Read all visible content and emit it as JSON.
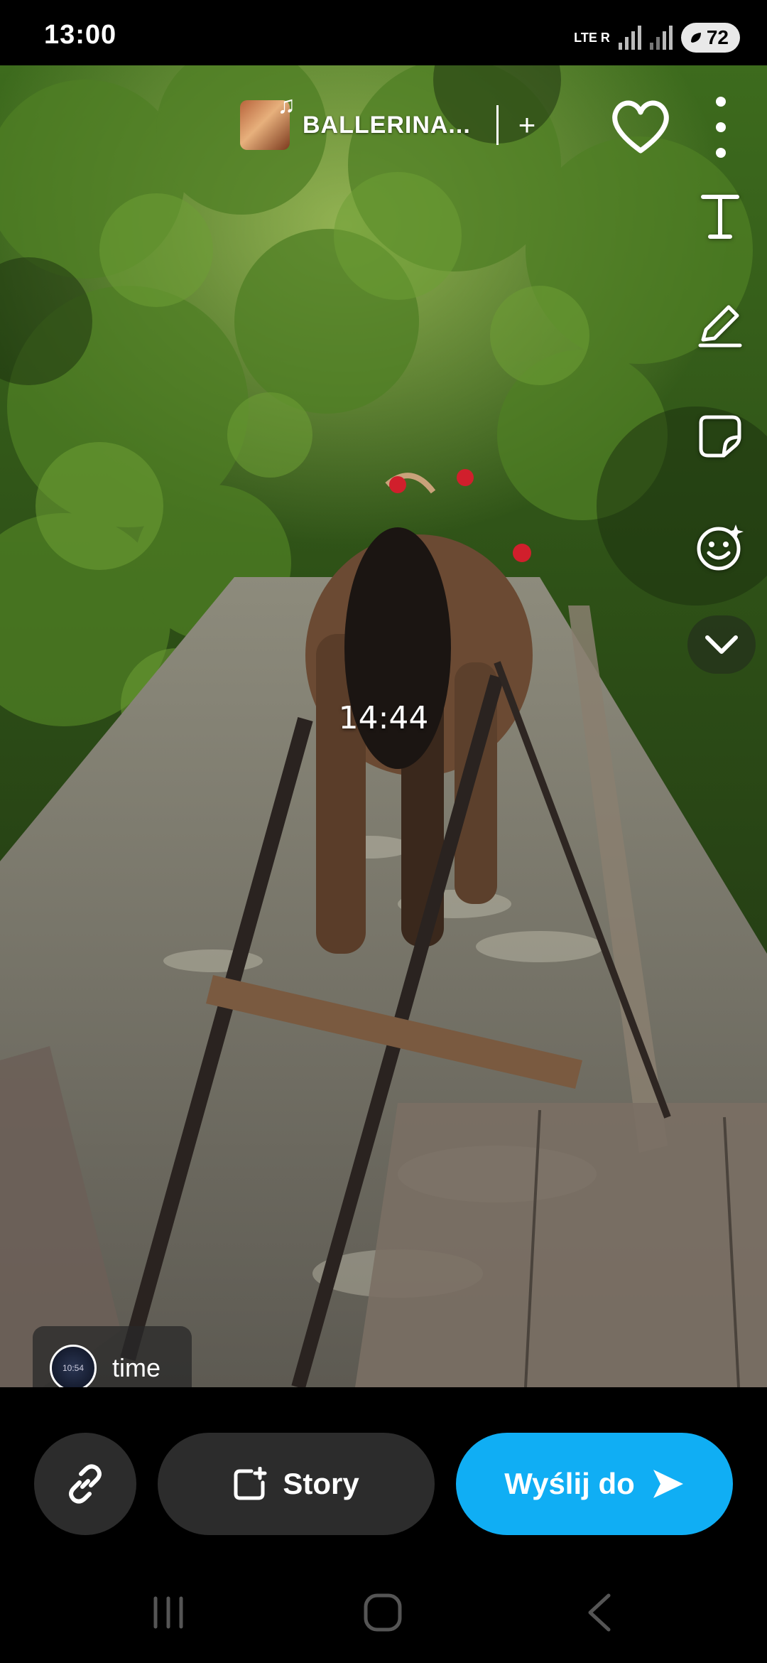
{
  "status_bar": {
    "time": "13:00",
    "network_label": "LTE R",
    "battery": "72"
  },
  "music": {
    "title": "BALLERINA...",
    "add_symbol": "+"
  },
  "sticker": {
    "time_text": "14:44"
  },
  "attachment": {
    "thumb_time": "10:54",
    "label": "time"
  },
  "actions": {
    "story_label": "Story",
    "send_label": "Wyślij do"
  },
  "icons": {
    "heart": "heart-icon",
    "more": "kebab-menu-icon",
    "text": "text-tool-icon",
    "draw": "pencil-icon",
    "sticker": "sticker-icon",
    "emoji": "emoji-sparkle-icon",
    "expand": "chevron-down-icon",
    "link": "link-icon",
    "story": "add-story-icon",
    "send": "send-arrow-icon"
  },
  "colors": {
    "send_button": "#10aef4",
    "pill_background": "#2c2c2c"
  }
}
